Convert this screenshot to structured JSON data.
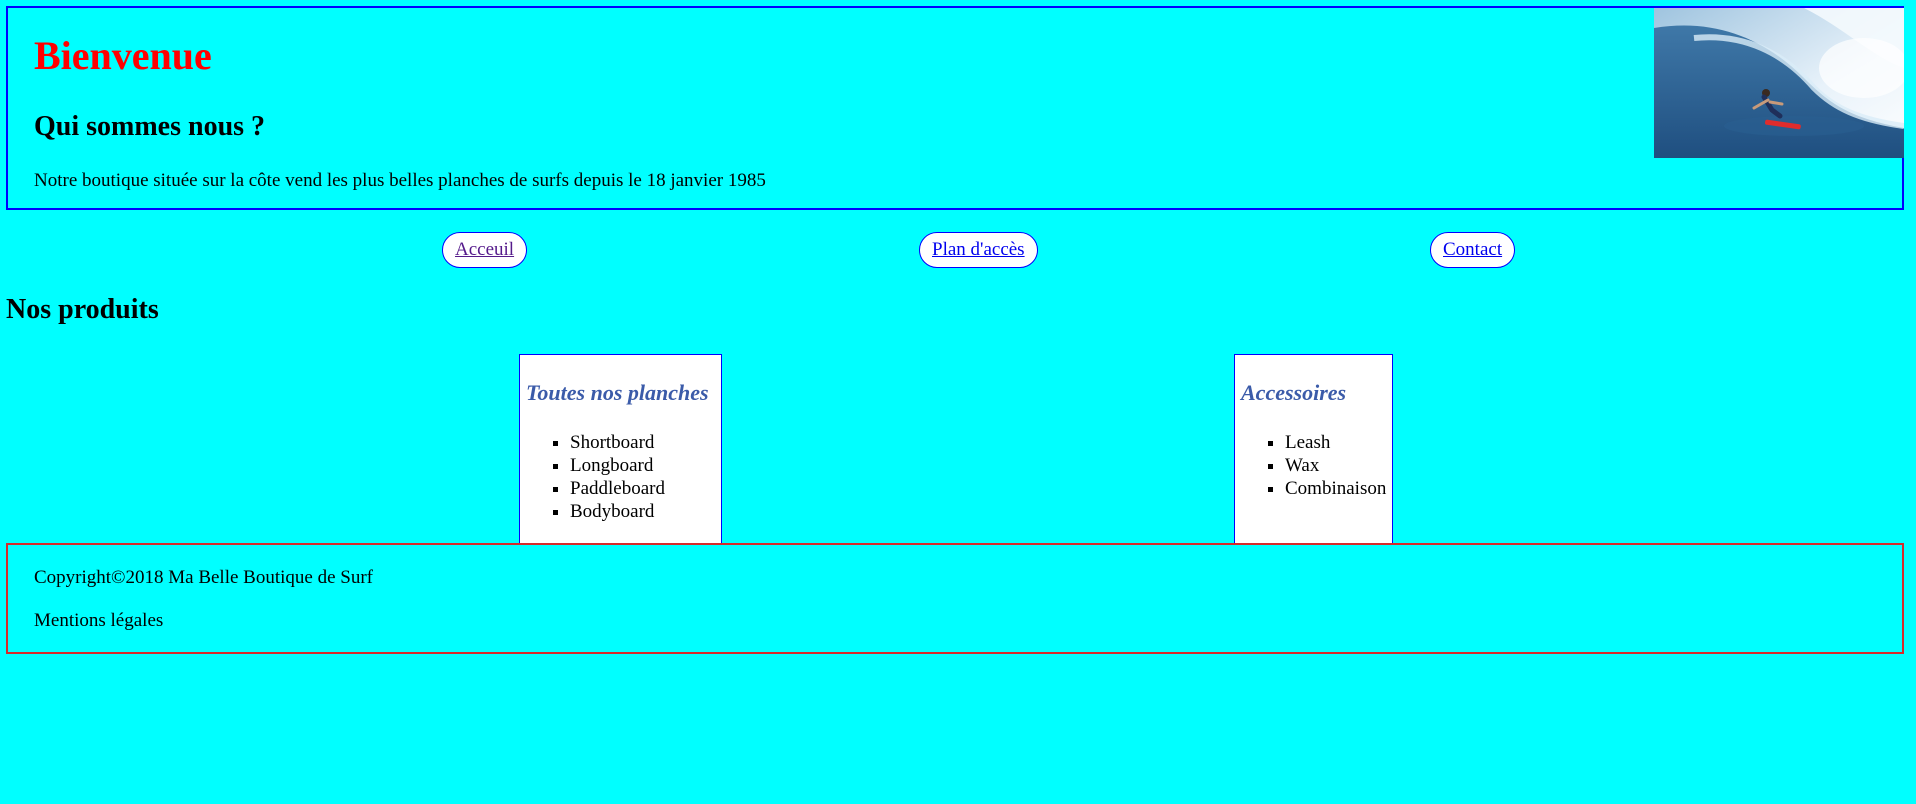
{
  "header": {
    "title": "Bienvenue",
    "subtitle": "Qui sommes nous ?",
    "text": "Notre boutique située sur la côte vend les plus belles planches de surfs depuis le 18 janvier 1985"
  },
  "nav": {
    "items": [
      {
        "label": "Acceuil",
        "visited": true
      },
      {
        "label": "Plan d'accès",
        "visited": false
      },
      {
        "label": "Contact",
        "visited": false
      }
    ]
  },
  "products": {
    "title": "Nos produits",
    "cards": [
      {
        "title": "Toutes nos planches",
        "items": [
          "Shortboard",
          "Longboard",
          "Paddleboard",
          "Bodyboard"
        ]
      },
      {
        "title": "Accessoires",
        "items": [
          "Leash",
          "Wax",
          "Combinaison"
        ]
      }
    ]
  },
  "footer": {
    "copyright": "Copyright©2018 Ma Belle Boutique de Surf",
    "legal": "Mentions légales"
  },
  "colors": {
    "background": "#00ffff",
    "header_border": "#0000ff",
    "title": "#ff0000",
    "card_title": "#3b5ba9",
    "footer_border": "#d62a2a"
  }
}
